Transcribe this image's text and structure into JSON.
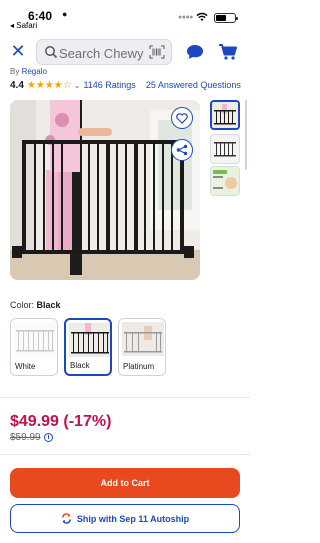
{
  "status_bar": {
    "time": "6:40",
    "back_app": "◂ Safari",
    "battery_level": 0.58
  },
  "header": {
    "search_placeholder": "Search Chewy"
  },
  "product": {
    "brand_prefix": "By",
    "brand": "Regalo",
    "rating": "4.4",
    "stars": "★★★★☆",
    "ratings_count": "1146 Ratings",
    "answered": "25 Answered Questions"
  },
  "color": {
    "label": "Color:",
    "selected": "Black",
    "options": [
      {
        "name": "White"
      },
      {
        "name": "Black"
      },
      {
        "name": "Platinum"
      }
    ]
  },
  "pricing": {
    "price": "$49.99 (-17%)",
    "was_price": "$59.99"
  },
  "actions": {
    "add_to_cart": "Add to Cart",
    "autoship": "Ship with Sep 11 Autoship"
  },
  "colors": {
    "accent": "#1c49c2",
    "cta": "#e8491f",
    "sale": "#c0124c"
  }
}
